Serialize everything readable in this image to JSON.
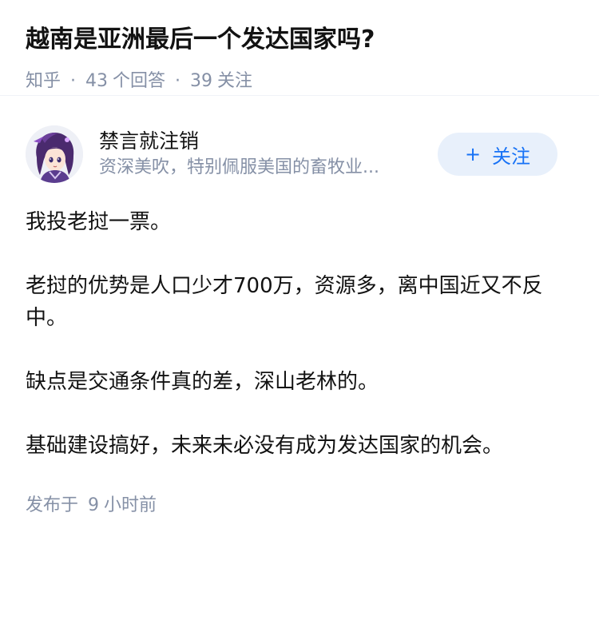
{
  "question": {
    "title": "越南是亚洲最后一个发达国家吗?",
    "source": "知乎",
    "answer_count": "43",
    "answer_label": "个回答",
    "follow_count": "39",
    "follow_label": "关注",
    "separator": "·"
  },
  "answer": {
    "author": {
      "name": "禁言就注销",
      "bio": "资深美吹，特别佩服美国的畜牧业...",
      "avatar_icon": "avatar-image"
    },
    "follow_button": {
      "icon": "+",
      "label": "关注"
    },
    "paragraphs": [
      "我投老挝一票。",
      "老挝的优势是人口少才700万，资源多，离中国近又不反中。",
      "缺点是交通条件真的差，深山老林的。",
      "基础建设搞好，未来未必没有成为发达国家的机会。"
    ],
    "time": {
      "prefix": "发布于",
      "value": "9",
      "unit": "小时前"
    }
  },
  "colors": {
    "accent": "#1772f6",
    "accent_bg": "#e8f0fb",
    "meta_text": "#8590a6",
    "main_text": "#121212"
  }
}
